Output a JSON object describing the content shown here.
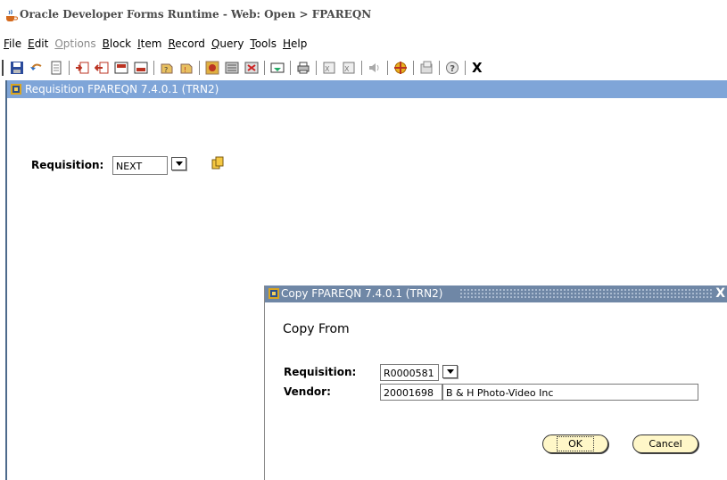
{
  "window": {
    "title": "Oracle Developer Forms Runtime - Web:  Open > FPAREQN"
  },
  "menu": [
    {
      "mnemonic": "F",
      "rest": "ile",
      "disabled": false
    },
    {
      "mnemonic": "E",
      "rest": "dit",
      "disabled": false
    },
    {
      "mnemonic": "O",
      "rest": "ptions",
      "disabled": true
    },
    {
      "mnemonic": "B",
      "rest": "lock",
      "disabled": false
    },
    {
      "mnemonic": "I",
      "rest": "tem",
      "disabled": false
    },
    {
      "mnemonic": "R",
      "rest": "ecord",
      "disabled": false
    },
    {
      "mnemonic": "Q",
      "rest": "uery",
      "disabled": false
    },
    {
      "mnemonic": "T",
      "rest": "ools",
      "disabled": false
    },
    {
      "mnemonic": "H",
      "rest": "elp",
      "disabled": false
    }
  ],
  "toolbar": {
    "exit_label": "X",
    "icons": [
      "save-icon",
      "rollback-icon",
      "print-page-icon",
      "insert-record-icon",
      "remove-record-icon",
      "duplicate-record-icon",
      "clear-record-icon",
      "enter-query-icon",
      "execute-query-icon",
      "next-block-icon",
      "previous-block-icon",
      "delete-block-icon",
      "options-icon",
      "print-icon",
      "list-values-icon",
      "export-icon",
      "volume-icon",
      "target-icon",
      "window-icon",
      "help-icon"
    ]
  },
  "form": {
    "title": "Requisition  FPAREQN  7.4.0.1  (TRN2)",
    "requisition_label": "Requisition:",
    "requisition_value": "NEXT"
  },
  "dialog": {
    "title": "Copy  FPAREQN  7.4.0.1  (TRN2)",
    "close_label": "X",
    "heading": "Copy From",
    "requisition_label": "Requisition:",
    "requisition_value": "R0000581",
    "vendor_label": "Vendor:",
    "vendor_id": "20001698",
    "vendor_name": "B & H Photo-Video Inc",
    "ok_label": "OK",
    "cancel_label": "Cancel"
  }
}
